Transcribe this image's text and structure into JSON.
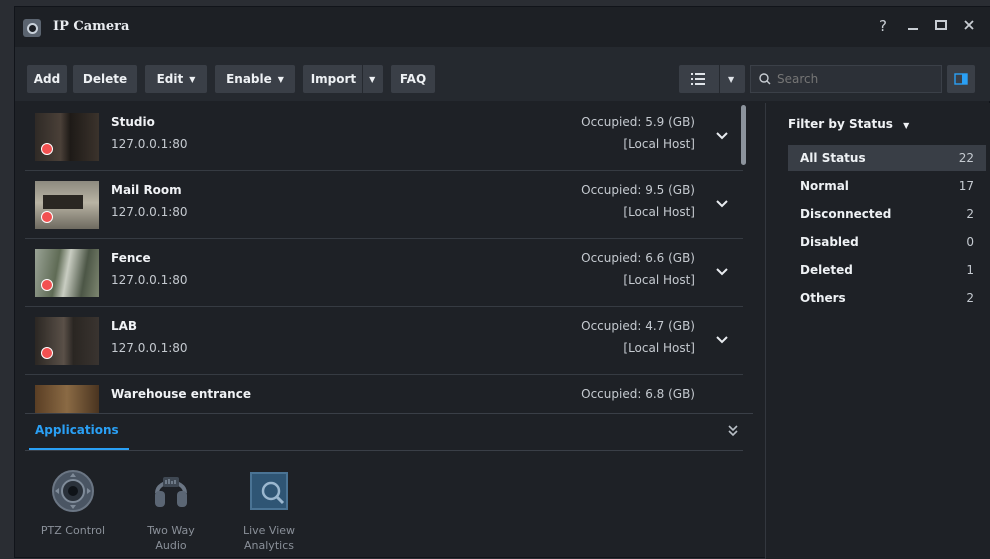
{
  "window": {
    "title": "IP Camera",
    "controls": [
      "?",
      "—",
      "□",
      "✕"
    ]
  },
  "toolbar": {
    "add": "Add",
    "delete": "Delete",
    "edit": "Edit",
    "enable": "Enable",
    "import": "Import",
    "faq": "FAQ",
    "search_placeholder": "Search"
  },
  "cameras": [
    {
      "name": "Studio",
      "ip": "127.0.0.1:80",
      "occupied": "Occupied: 5.9 (GB)",
      "host": "[Local Host]",
      "status_color": "#f25151"
    },
    {
      "name": "Mail Room",
      "ip": "127.0.0.1:80",
      "occupied": "Occupied: 9.5 (GB)",
      "host": "[Local Host]",
      "status_color": "#f25151"
    },
    {
      "name": "Fence",
      "ip": "127.0.0.1:80",
      "occupied": "Occupied: 6.6 (GB)",
      "host": "[Local Host]",
      "status_color": "#f25151"
    },
    {
      "name": "LAB",
      "ip": "127.0.0.1:80",
      "occupied": "Occupied: 4.7 (GB)",
      "host": "[Local Host]",
      "status_color": "#f25151"
    },
    {
      "name": "Warehouse entrance",
      "ip": "",
      "occupied": "Occupied: 6.8 (GB)",
      "host": "",
      "status_color": "#f25151"
    }
  ],
  "applications": {
    "tab": "Applications",
    "items": [
      {
        "label1": "PTZ Control",
        "label2": "",
        "icon": "ptz-control-icon"
      },
      {
        "label1": "Two Way",
        "label2": "Audio",
        "icon": "two-way-audio-icon"
      },
      {
        "label1": "Live View",
        "label2": "Analytics",
        "icon": "live-view-analytics-icon"
      }
    ]
  },
  "filter": {
    "title": "Filter by Status",
    "items": [
      {
        "label": "All Status",
        "count": "22",
        "active": true
      },
      {
        "label": "Normal",
        "count": "17",
        "active": false
      },
      {
        "label": "Disconnected",
        "count": "2",
        "active": false
      },
      {
        "label": "Disabled",
        "count": "0",
        "active": false
      },
      {
        "label": "Deleted",
        "count": "1",
        "active": false
      },
      {
        "label": "Others",
        "count": "2",
        "active": false
      }
    ]
  },
  "colors": {
    "accent": "#2aa0f5",
    "status_dot": "#f25151",
    "panel_bg": "#1e2126",
    "button_bg": "#3a3f47"
  }
}
